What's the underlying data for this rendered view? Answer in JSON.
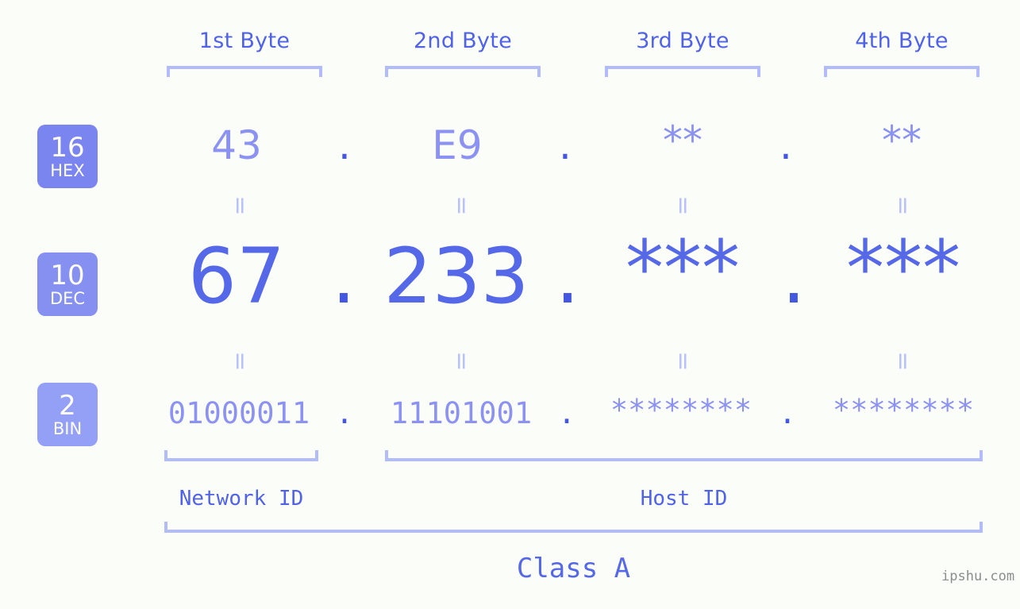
{
  "background_color": "#fbfdf8",
  "colors": {
    "badge_bg_hex": "#7b85ef",
    "badge_bg_dec": "#8690f1",
    "badge_bg_bin": "#93a0f6",
    "bracket": "#b3bcfb",
    "header_text": "#4f62e8",
    "hex_text": "#8b92f2",
    "dec_text": "#5568e8",
    "bin_text": "#8b92f2",
    "dot": "#4457e0",
    "equals": "#b9c1fb",
    "watermark": "#8d8d8d"
  },
  "headers": {
    "bytes": [
      {
        "label": "1st Byte"
      },
      {
        "label": "2nd Byte"
      },
      {
        "label": "3rd Byte"
      },
      {
        "label": "4th Byte"
      }
    ]
  },
  "bases": [
    {
      "number": "16",
      "name": "HEX"
    },
    {
      "number": "10",
      "name": "DEC"
    },
    {
      "number": "2",
      "name": "BIN"
    }
  ],
  "rows": {
    "hex": {
      "values": [
        "43",
        "E9",
        "**",
        "**"
      ],
      "separator": "."
    },
    "dec": {
      "values": [
        "67",
        "233",
        "***",
        "***"
      ],
      "separator": "."
    },
    "bin": {
      "values": [
        "01000011",
        "11101001",
        "********",
        "********"
      ],
      "separator": "."
    }
  },
  "equals_symbol": "=",
  "segments": {
    "network_id": "Network ID",
    "host_id": "Host ID",
    "class": "Class A"
  },
  "watermark": "ipshu.com"
}
